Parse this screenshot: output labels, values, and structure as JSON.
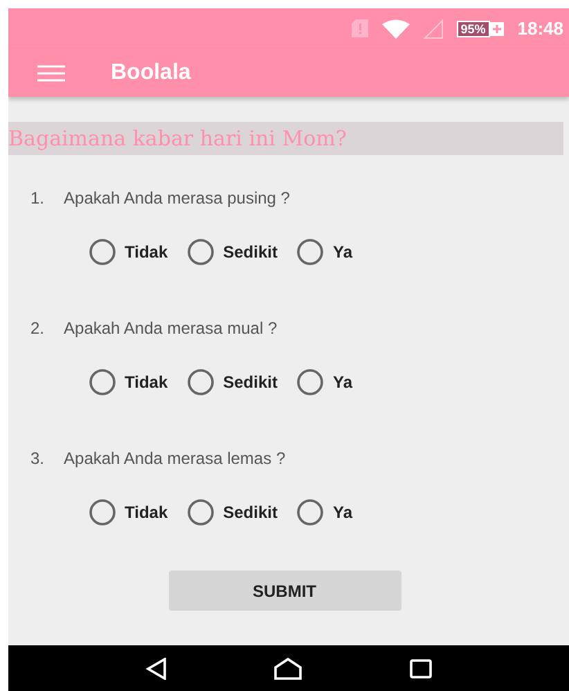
{
  "status_bar": {
    "battery": "95%",
    "time": "18:48"
  },
  "toolbar": {
    "title": "Boolala"
  },
  "heading": "Bagaimana kabar hari ini Mom?",
  "questions": [
    {
      "number": "1.",
      "text": "Apakah Anda merasa pusing ?",
      "options": [
        {
          "label": "Tidak",
          "selected": false
        },
        {
          "label": "Sedikit",
          "selected": false
        },
        {
          "label": "Ya",
          "selected": false
        }
      ]
    },
    {
      "number": "2.",
      "text": "Apakah Anda merasa mual ?",
      "options": [
        {
          "label": "Tidak",
          "selected": false
        },
        {
          "label": "Sedikit",
          "selected": false
        },
        {
          "label": "Ya",
          "selected": false
        }
      ]
    },
    {
      "number": "3.",
      "text": "Apakah Anda merasa lemas ?",
      "options": [
        {
          "label": "Tidak",
          "selected": false
        },
        {
          "label": "Sedikit",
          "selected": false
        },
        {
          "label": "Ya",
          "selected": false
        }
      ]
    }
  ],
  "submit": "SUBMIT"
}
